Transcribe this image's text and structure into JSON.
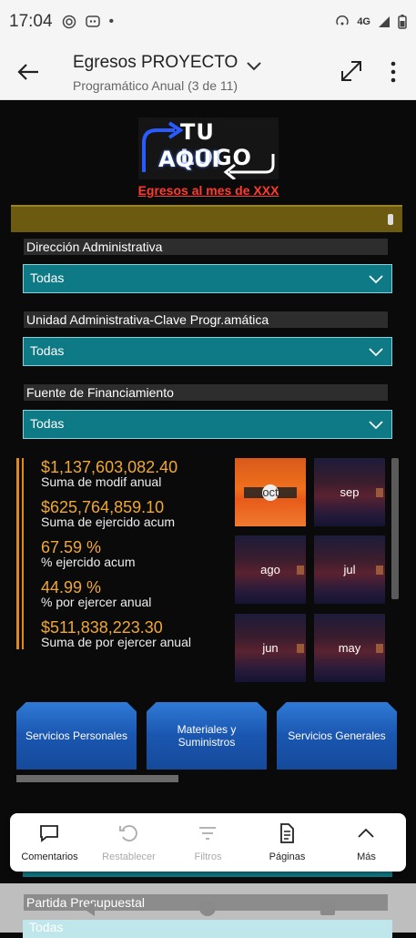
{
  "status_bar": {
    "time": "17:04",
    "network": "4G"
  },
  "app_bar": {
    "title": "Egresos PROYECTO",
    "subtitle": "Programático Anual (3 de 11)"
  },
  "report": {
    "logo": {
      "line1": "TU LOGO",
      "line2": "AQUI"
    },
    "header_link": "Egresos al mes de XXX",
    "filters": [
      {
        "label": "Dirección Administrativa",
        "value": "Todas"
      },
      {
        "label": "Unidad Administrativa-Clave Progr.amática",
        "value": "Todas"
      },
      {
        "label": "Fuente de Financiamiento",
        "value": "Todas"
      }
    ],
    "kpis": [
      {
        "value": "$1,137,603,082.40",
        "label": "Suma de modif anual"
      },
      {
        "value": "$625,764,859.10",
        "label": "Suma de ejercido acum"
      },
      {
        "value": "67.59 %",
        "label": "% ejercido acum"
      },
      {
        "value": "44.99 %",
        "label": "% por ejercer anual"
      },
      {
        "value": "$511,838,223.30",
        "label": "Suma de por ejercer anual"
      }
    ],
    "months": [
      {
        "label": "oct",
        "selected": true
      },
      {
        "label": "sep",
        "selected": false
      },
      {
        "label": "ago",
        "selected": false
      },
      {
        "label": "jul",
        "selected": false
      },
      {
        "label": "jun",
        "selected": false
      },
      {
        "label": "may",
        "selected": false
      }
    ],
    "categories": [
      "Servicios Personales",
      "Materiales y Suministros",
      "Servicios Generales"
    ],
    "next_filter": {
      "label": "Partida Presupuestal",
      "value": "Todas"
    }
  },
  "bottom_menu": [
    {
      "label": "Comentarios",
      "icon": "comment-icon",
      "disabled": false
    },
    {
      "label": "Restablecer",
      "icon": "reset-icon",
      "disabled": true
    },
    {
      "label": "Filtros",
      "icon": "filter-icon",
      "disabled": true
    },
    {
      "label": "Páginas",
      "icon": "pages-icon",
      "disabled": false
    },
    {
      "label": "Más",
      "icon": "chevron-up-icon",
      "disabled": false
    }
  ]
}
